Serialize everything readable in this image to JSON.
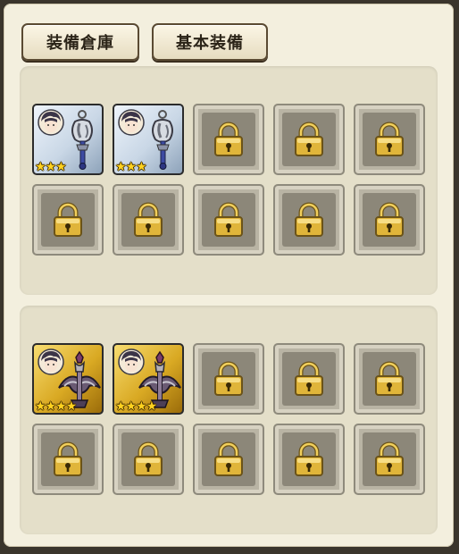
{
  "tabs": [
    {
      "label": "装備倉庫"
    },
    {
      "label": "基本装備"
    }
  ],
  "sections": [
    {
      "slots": [
        {
          "state": "equipped",
          "rarity": "silver",
          "stars": "★★★",
          "star_count": 3,
          "icon": "staff-icon"
        },
        {
          "state": "equipped",
          "rarity": "silver",
          "stars": "★★★",
          "star_count": 3,
          "icon": "staff-icon"
        },
        {
          "state": "locked",
          "icon": "lock-icon"
        },
        {
          "state": "locked",
          "icon": "lock-icon"
        },
        {
          "state": "locked",
          "icon": "lock-icon"
        },
        {
          "state": "locked",
          "icon": "lock-icon"
        },
        {
          "state": "locked",
          "icon": "lock-icon"
        },
        {
          "state": "locked",
          "icon": "lock-icon"
        },
        {
          "state": "locked",
          "icon": "lock-icon"
        },
        {
          "state": "locked",
          "icon": "lock-icon"
        }
      ]
    },
    {
      "slots": [
        {
          "state": "equipped",
          "rarity": "gold",
          "stars": "★★★★",
          "star_count": 4,
          "icon": "crossbow-icon"
        },
        {
          "state": "equipped",
          "rarity": "gold",
          "stars": "★★★★",
          "star_count": 4,
          "icon": "crossbow-icon"
        },
        {
          "state": "locked",
          "icon": "lock-icon"
        },
        {
          "state": "locked",
          "icon": "lock-icon"
        },
        {
          "state": "locked",
          "icon": "lock-icon"
        },
        {
          "state": "locked",
          "icon": "lock-icon"
        },
        {
          "state": "locked",
          "icon": "lock-icon"
        },
        {
          "state": "locked",
          "icon": "lock-icon"
        },
        {
          "state": "locked",
          "icon": "lock-icon"
        },
        {
          "state": "locked",
          "icon": "lock-icon"
        }
      ]
    }
  ],
  "colors": {
    "window_bg": "#f3efde",
    "panel_bg": "#e4dfc9",
    "lock_gold": "#e0b53a",
    "silver_frame": "#c9d7e6",
    "gold_frame": "#d9a923",
    "star": "#ffd21f"
  }
}
